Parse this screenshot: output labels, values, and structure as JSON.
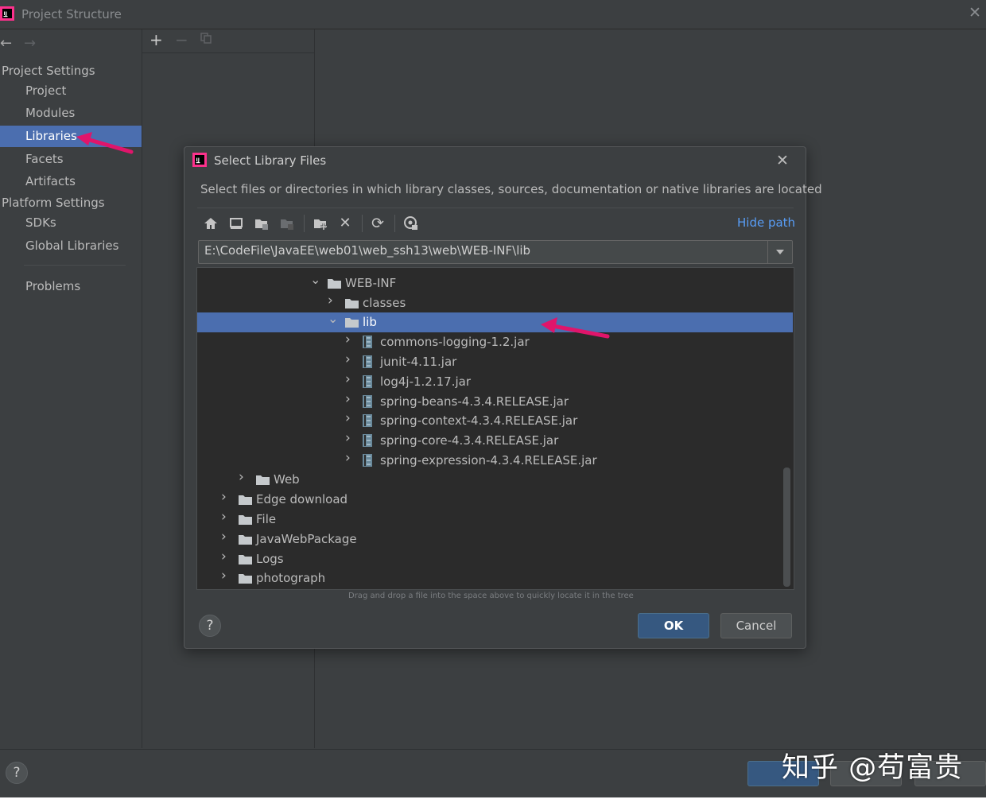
{
  "window": {
    "title": "Project Structure"
  },
  "sidebar": {
    "project_settings_header": "Project Settings",
    "platform_settings_header": "Platform Settings",
    "items": {
      "project": "Project",
      "modules": "Modules",
      "libraries": "Libraries",
      "facets": "Facets",
      "artifacts": "Artifacts",
      "sdks": "SDKs",
      "global_libraries": "Global Libraries",
      "problems": "Problems"
    },
    "selected": "Libraries"
  },
  "dialog": {
    "title": "Select Library Files",
    "description": "Select files or directories in which library classes, sources, documentation or native libraries are located",
    "hide_path_link": "Hide path",
    "path_value": "E:\\CodeFile\\JavaEE\\web01\\web_ssh13\\web\\WEB-INF\\lib",
    "tree": [
      {
        "label": "WEB-INF",
        "type": "folder",
        "expanded": true
      },
      {
        "label": "classes",
        "type": "folder",
        "expanded": false
      },
      {
        "label": "lib",
        "type": "folder",
        "expanded": true,
        "selected": true
      },
      {
        "label": "commons-logging-1.2.jar",
        "type": "jar"
      },
      {
        "label": "junit-4.11.jar",
        "type": "jar"
      },
      {
        "label": "log4j-1.2.17.jar",
        "type": "jar"
      },
      {
        "label": "spring-beans-4.3.4.RELEASE.jar",
        "type": "jar"
      },
      {
        "label": "spring-context-4.3.4.RELEASE.jar",
        "type": "jar"
      },
      {
        "label": "spring-core-4.3.4.RELEASE.jar",
        "type": "jar"
      },
      {
        "label": "spring-expression-4.3.4.RELEASE.jar",
        "type": "jar"
      },
      {
        "label": "Web",
        "type": "folder",
        "expanded": false
      },
      {
        "label": "Edge download",
        "type": "folder",
        "expanded": false
      },
      {
        "label": "File",
        "type": "folder",
        "expanded": false
      },
      {
        "label": "JavaWebPackage",
        "type": "folder",
        "expanded": false
      },
      {
        "label": "Logs",
        "type": "folder",
        "expanded": false
      },
      {
        "label": "photograph",
        "type": "folder",
        "expanded": false
      }
    ],
    "hint": "Drag and drop a file into the space above to quickly locate it in the tree",
    "ok_label": "OK",
    "cancel_label": "Cancel",
    "help_label": "?"
  },
  "bottom": {
    "help_label": "?"
  },
  "watermark": "知乎 @苟富贵",
  "colors": {
    "background": "#3c3f41",
    "selection": "#4b6eaf",
    "link": "#589df6",
    "ok_button": "#365880",
    "annotation_arrow": "#e0156b"
  },
  "icons": [
    "back-arrow-icon",
    "forward-arrow-icon",
    "add-icon",
    "remove-icon",
    "copy-icon",
    "home-icon",
    "desktop-icon",
    "project-folder-icon",
    "module-folder-icon",
    "new-folder-icon",
    "delete-icon",
    "refresh-icon",
    "show-hidden-icon",
    "close-icon",
    "help-icon",
    "folder-icon",
    "jar-icon",
    "chevron-right-icon",
    "chevron-down-icon"
  ]
}
